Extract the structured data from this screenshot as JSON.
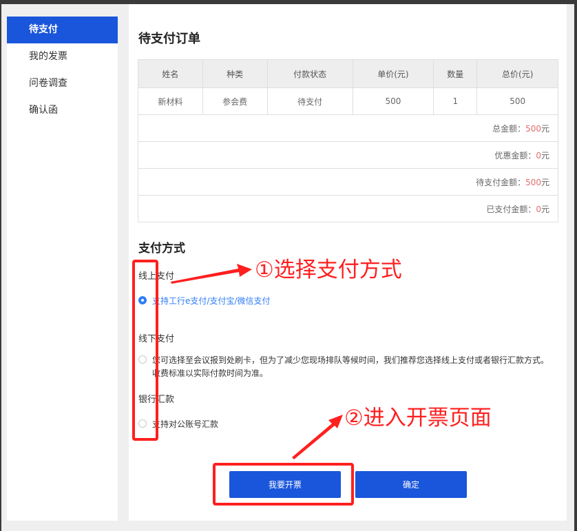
{
  "sidebar": {
    "items": [
      {
        "label": "待支付",
        "active": true
      },
      {
        "label": "我的发票"
      },
      {
        "label": "问卷调查"
      },
      {
        "label": "确认函"
      }
    ]
  },
  "main": {
    "title": "待支付订单",
    "table": {
      "headers": [
        "姓名",
        "种类",
        "付款状态",
        "单价(元)",
        "数量",
        "总价(元)"
      ],
      "row": [
        "新材料",
        "参会费",
        "待支付",
        "500",
        "1",
        "500"
      ],
      "summary": [
        {
          "label": "总金额：",
          "value": "500",
          "unit": "元"
        },
        {
          "label": "优惠金额：",
          "value": "0",
          "unit": "元"
        },
        {
          "label": "待支付金额：",
          "value": "500",
          "unit": "元"
        },
        {
          "label": "已支付金额：",
          "value": "0",
          "unit": "元"
        }
      ]
    },
    "payment": {
      "title": "支付方式",
      "online": {
        "title": "线上支付",
        "option": "支持工行e支付/支付宝/微信支付"
      },
      "offline": {
        "title": "线下支付",
        "option": "您可选择至会议报到处刷卡，但为了减少您现场排队等候时间，我们推荐您选择线上支付或者银行汇款方式。收费标准以实际付款时间为准。"
      },
      "bank": {
        "title": "银行汇款",
        "option": "支持对公账号汇款"
      }
    },
    "buttons": {
      "invoice": "我要开票",
      "confirm": "确定"
    }
  },
  "annotations": {
    "step1": "①选择支付方式",
    "step2": "②进入开票页面",
    "color": "#ff1f1f"
  },
  "colors": {
    "primary": "#1a56db",
    "link": "#2f7df6",
    "amount": "#e06c6c"
  }
}
